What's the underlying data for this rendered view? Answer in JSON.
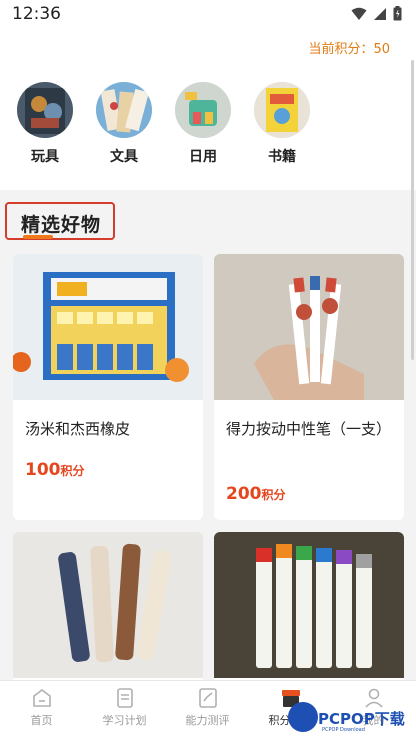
{
  "status_bar": {
    "time": "12:36"
  },
  "header": {
    "points_label": "当前积分：50"
  },
  "categories": [
    {
      "label": "玩具",
      "icon": "toy-image"
    },
    {
      "label": "文具",
      "icon": "stationery-image"
    },
    {
      "label": "日用",
      "icon": "daily-goods-image"
    },
    {
      "label": "书籍",
      "icon": "books-image"
    }
  ],
  "section": {
    "title": "精选好物"
  },
  "products": [
    {
      "name": "汤米和杰西橡皮",
      "price": "100",
      "unit": "积分"
    },
    {
      "name": "得力按动中性笔（一支）",
      "price": "200",
      "unit": "积分"
    },
    {
      "name": "",
      "price": "",
      "unit": ""
    },
    {
      "name": "",
      "price": "",
      "unit": ""
    }
  ],
  "bottom_nav": [
    {
      "label": "首页"
    },
    {
      "label": "学习计划"
    },
    {
      "label": "能力测评"
    },
    {
      "label": "积分商城"
    },
    {
      "label": "我的"
    }
  ],
  "watermark": {
    "text": "PCPOP下载",
    "sub": "PCPOP Download"
  },
  "colors": {
    "accent": "#e07b12",
    "price": "#e5461e",
    "highlight_box": "#d43c2c",
    "watermark": "#1e4fb3"
  }
}
